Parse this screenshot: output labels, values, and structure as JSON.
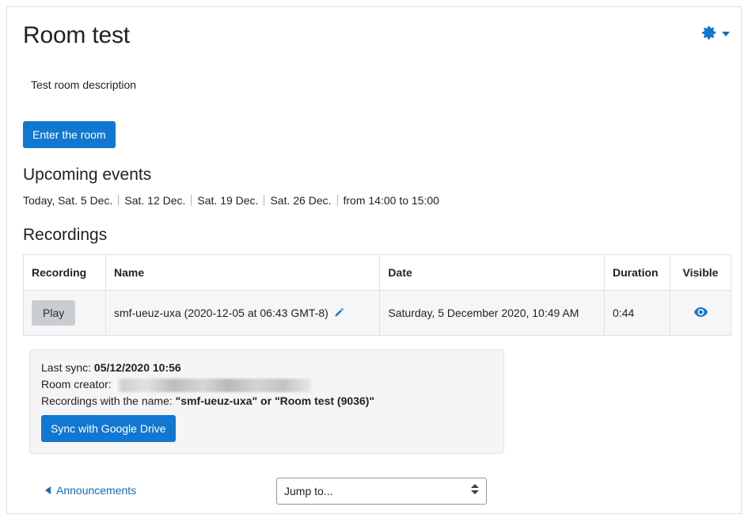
{
  "header": {
    "title": "Room test",
    "gear_icon": "gear-icon",
    "caret_icon": "chevron-down-icon"
  },
  "room": {
    "description": "Test room description",
    "enter_button": "Enter the room"
  },
  "upcoming": {
    "heading": "Upcoming events",
    "events": [
      "Today, Sat. 5 Dec.",
      "Sat. 12 Dec.",
      "Sat. 19 Dec.",
      "Sat. 26 Dec."
    ],
    "time_range": "from 14:00 to 15:00"
  },
  "recordings": {
    "heading": "Recordings",
    "columns": [
      "Recording",
      "Name",
      "Date",
      "Duration",
      "Visible"
    ],
    "rows": [
      {
        "play_label": "Play",
        "name": "smf-ueuz-uxa (2020-12-05 at 06:43 GMT-8)",
        "edit_icon": "pencil-icon",
        "date": "Saturday, 5 December 2020, 10:49 AM",
        "duration": "0:44",
        "visible_icon": "eye-icon"
      }
    ]
  },
  "sync": {
    "last_sync_label": "Last sync:",
    "last_sync_value": "05/12/2020 10:56",
    "creator_label": "Room creator:",
    "creator_value": "",
    "names_label": "Recordings with the name:",
    "names_value": "\"smf-ueuz-uxa\" or \"Room test (9036)\"",
    "sync_button": "Sync with Google Drive"
  },
  "bottom_nav": {
    "prev_icon": "triangle-left-icon",
    "prev_label": "Announcements",
    "jump_placeholder": "Jump to...",
    "jump_options": [
      "Jump to..."
    ]
  },
  "colors": {
    "primary_blue": "#1177d1",
    "link_blue": "#0f6cbd",
    "icon_blue": "#1177d1",
    "play_gray": "#c8cdd2",
    "row_gray": "#f6f6f6",
    "box_gray": "#f5f5f5",
    "border_gray": "#dee2e6"
  }
}
